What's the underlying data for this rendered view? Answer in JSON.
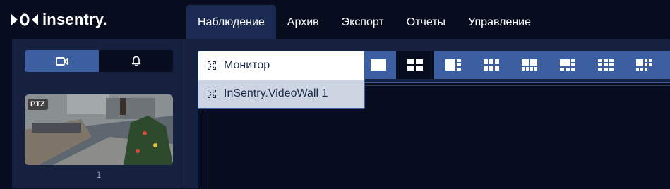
{
  "app": {
    "logo_text": "insentry."
  },
  "nav": {
    "tabs": [
      {
        "label": "Наблюдение",
        "active": true
      },
      {
        "label": "Архив",
        "active": false
      },
      {
        "label": "Экспорт",
        "active": false
      },
      {
        "label": "Отчеты",
        "active": false
      },
      {
        "label": "Управление",
        "active": false
      }
    ]
  },
  "sidebar": {
    "toggle": [
      {
        "icon": "video-camera-icon",
        "active": true
      },
      {
        "icon": "bell-icon",
        "active": false
      }
    ],
    "cameras": [
      {
        "badge": "PTZ",
        "label": "1"
      }
    ]
  },
  "layouts": {
    "active_index": 1,
    "items": [
      "single-layout-icon",
      "grid-2x2-layout-icon",
      "1-plus-3-layout-icon",
      "grid-3x2-layout-icon",
      "2-plus-4-layout-icon",
      "1-plus-5-layout-icon",
      "grid-3x3-layout-icon",
      "1-plus-7-layout-icon"
    ]
  },
  "display_menu": {
    "items": [
      {
        "label": "Монитор",
        "icon": "expand-icon",
        "highlighted": false
      },
      {
        "label": "InSentry.VideoWall 1",
        "icon": "expand-icon",
        "highlighted": true
      }
    ]
  },
  "colors": {
    "background": "#070d1f",
    "panel": "#15213f",
    "accent": "#3b5fa0",
    "active_tab": "#1a2a52",
    "menu_highlight": "#cdd5e3"
  }
}
